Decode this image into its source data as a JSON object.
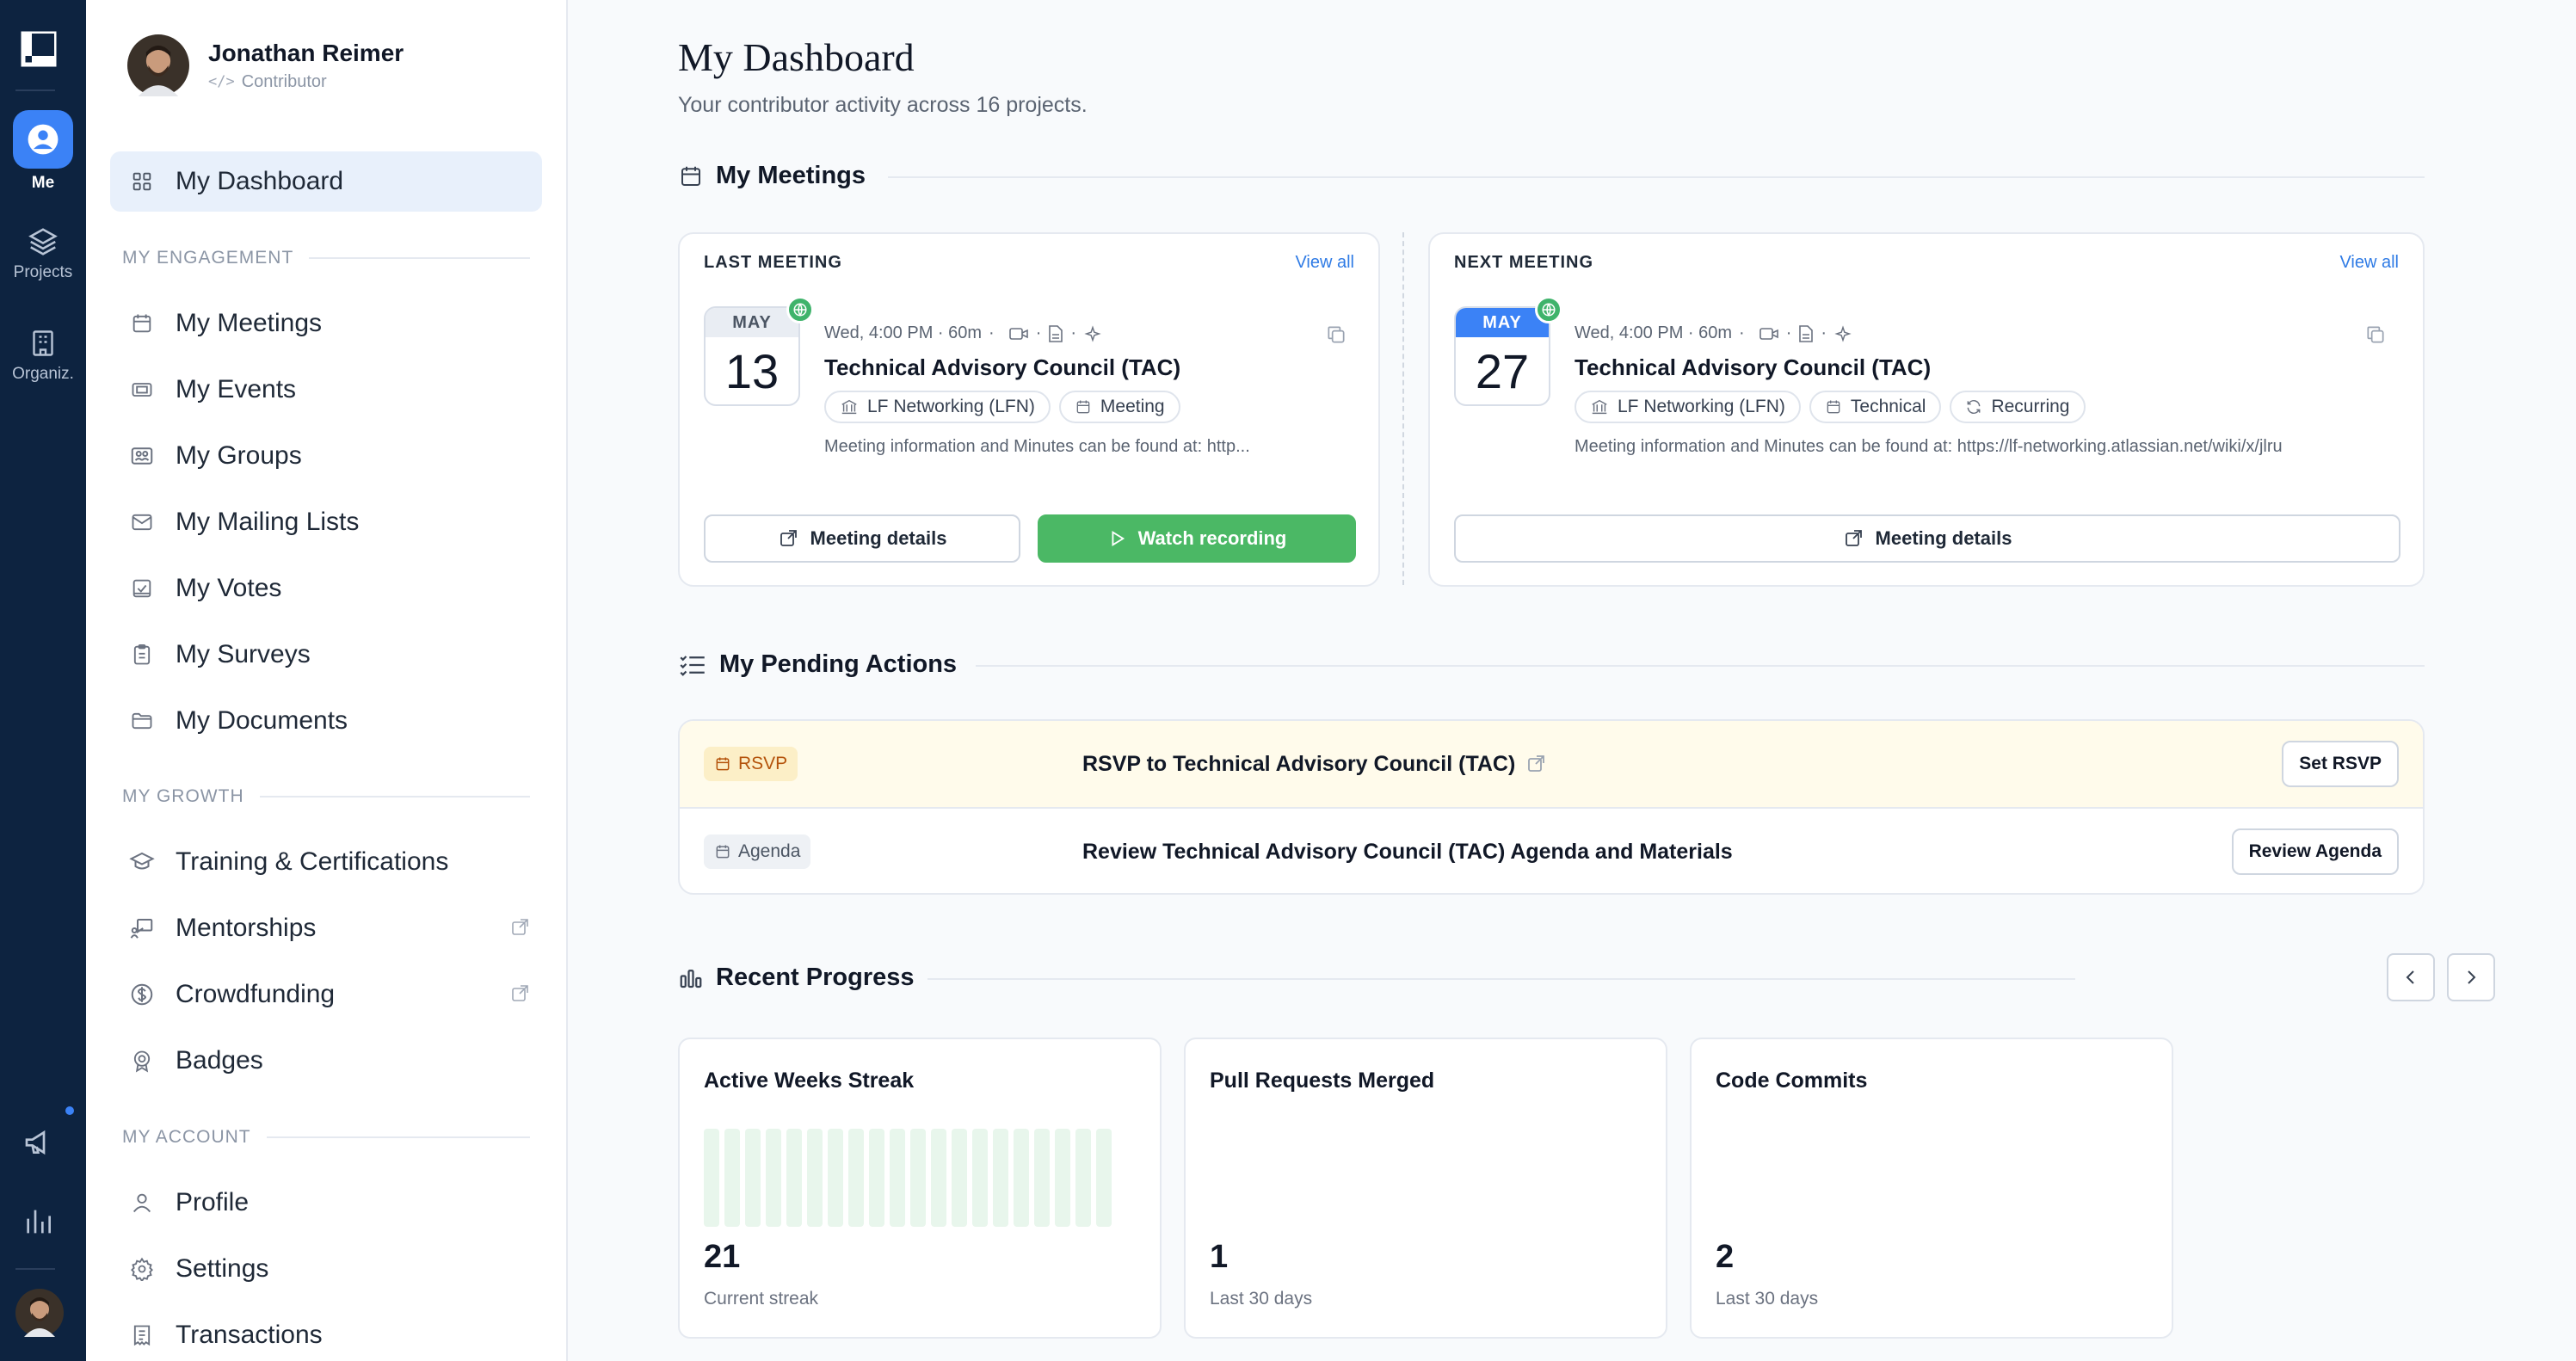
{
  "rail": {
    "items": [
      {
        "label": "Me",
        "icon": "user-icon"
      },
      {
        "label": "Projects",
        "icon": "layers-icon"
      },
      {
        "label": "Organiz.",
        "icon": "building-icon"
      }
    ]
  },
  "user": {
    "name": "Jonathan Reimer",
    "role": "Contributor"
  },
  "nav": {
    "dashboard": "My Dashboard",
    "engagement_header": "MY ENGAGEMENT",
    "engagement": [
      "My Meetings",
      "My Events",
      "My Groups",
      "My Mailing Lists",
      "My Votes",
      "My Surveys",
      "My Documents"
    ],
    "growth_header": "MY GROWTH",
    "growth": [
      "Training & Certifications",
      "Mentorships",
      "Crowdfunding",
      "Badges"
    ],
    "account_header": "MY ACCOUNT",
    "account": [
      "Profile",
      "Settings",
      "Transactions"
    ]
  },
  "page": {
    "title": "My Dashboard",
    "subtitle": "Your contributor activity across 16 projects."
  },
  "meetings": {
    "title": "My Meetings",
    "last": {
      "header": "LAST MEETING",
      "view_all": "View all",
      "month": "MAY",
      "day": "13",
      "meta": "Wed, 4:00 PM · 60m",
      "title": "Technical Advisory Council (TAC)",
      "chips": [
        "LF Networking (LFN)",
        "Meeting"
      ],
      "description": "Meeting information and Minutes can be found at: http...",
      "details_btn": "Meeting details",
      "recording_btn": "Watch recording"
    },
    "next": {
      "header": "NEXT MEETING",
      "view_all": "View all",
      "month": "MAY",
      "day": "27",
      "meta": "Wed, 4:00 PM · 60m",
      "title": "Technical Advisory Council (TAC)",
      "chips": [
        "LF Networking (LFN)",
        "Technical",
        "Recurring"
      ],
      "description": "Meeting information and Minutes can be found at: https://lf-networking.atlassian.net/wiki/x/jlru",
      "details_btn": "Meeting details"
    }
  },
  "pending": {
    "title": "My Pending Actions",
    "rows": [
      {
        "tag": "RSVP",
        "text": "RSVP to Technical Advisory Council (TAC)",
        "button": "Set RSVP"
      },
      {
        "tag": "Agenda",
        "text": "Review Technical Advisory Council (TAC) Agenda and Materials",
        "button": "Review Agenda"
      }
    ]
  },
  "progress": {
    "title": "Recent Progress",
    "cards": [
      {
        "title": "Active Weeks Streak",
        "value": "21",
        "label": "Current streak"
      },
      {
        "title": "Pull Requests Merged",
        "value": "1",
        "label": "Last 30 days"
      },
      {
        "title": "Code Commits",
        "value": "2",
        "label": "Last 30 days"
      }
    ]
  },
  "colors": {
    "accent": "#3b82f6",
    "rail_bg": "#0d2340",
    "green": "#4bb865",
    "rsvp": "#b4530b"
  }
}
